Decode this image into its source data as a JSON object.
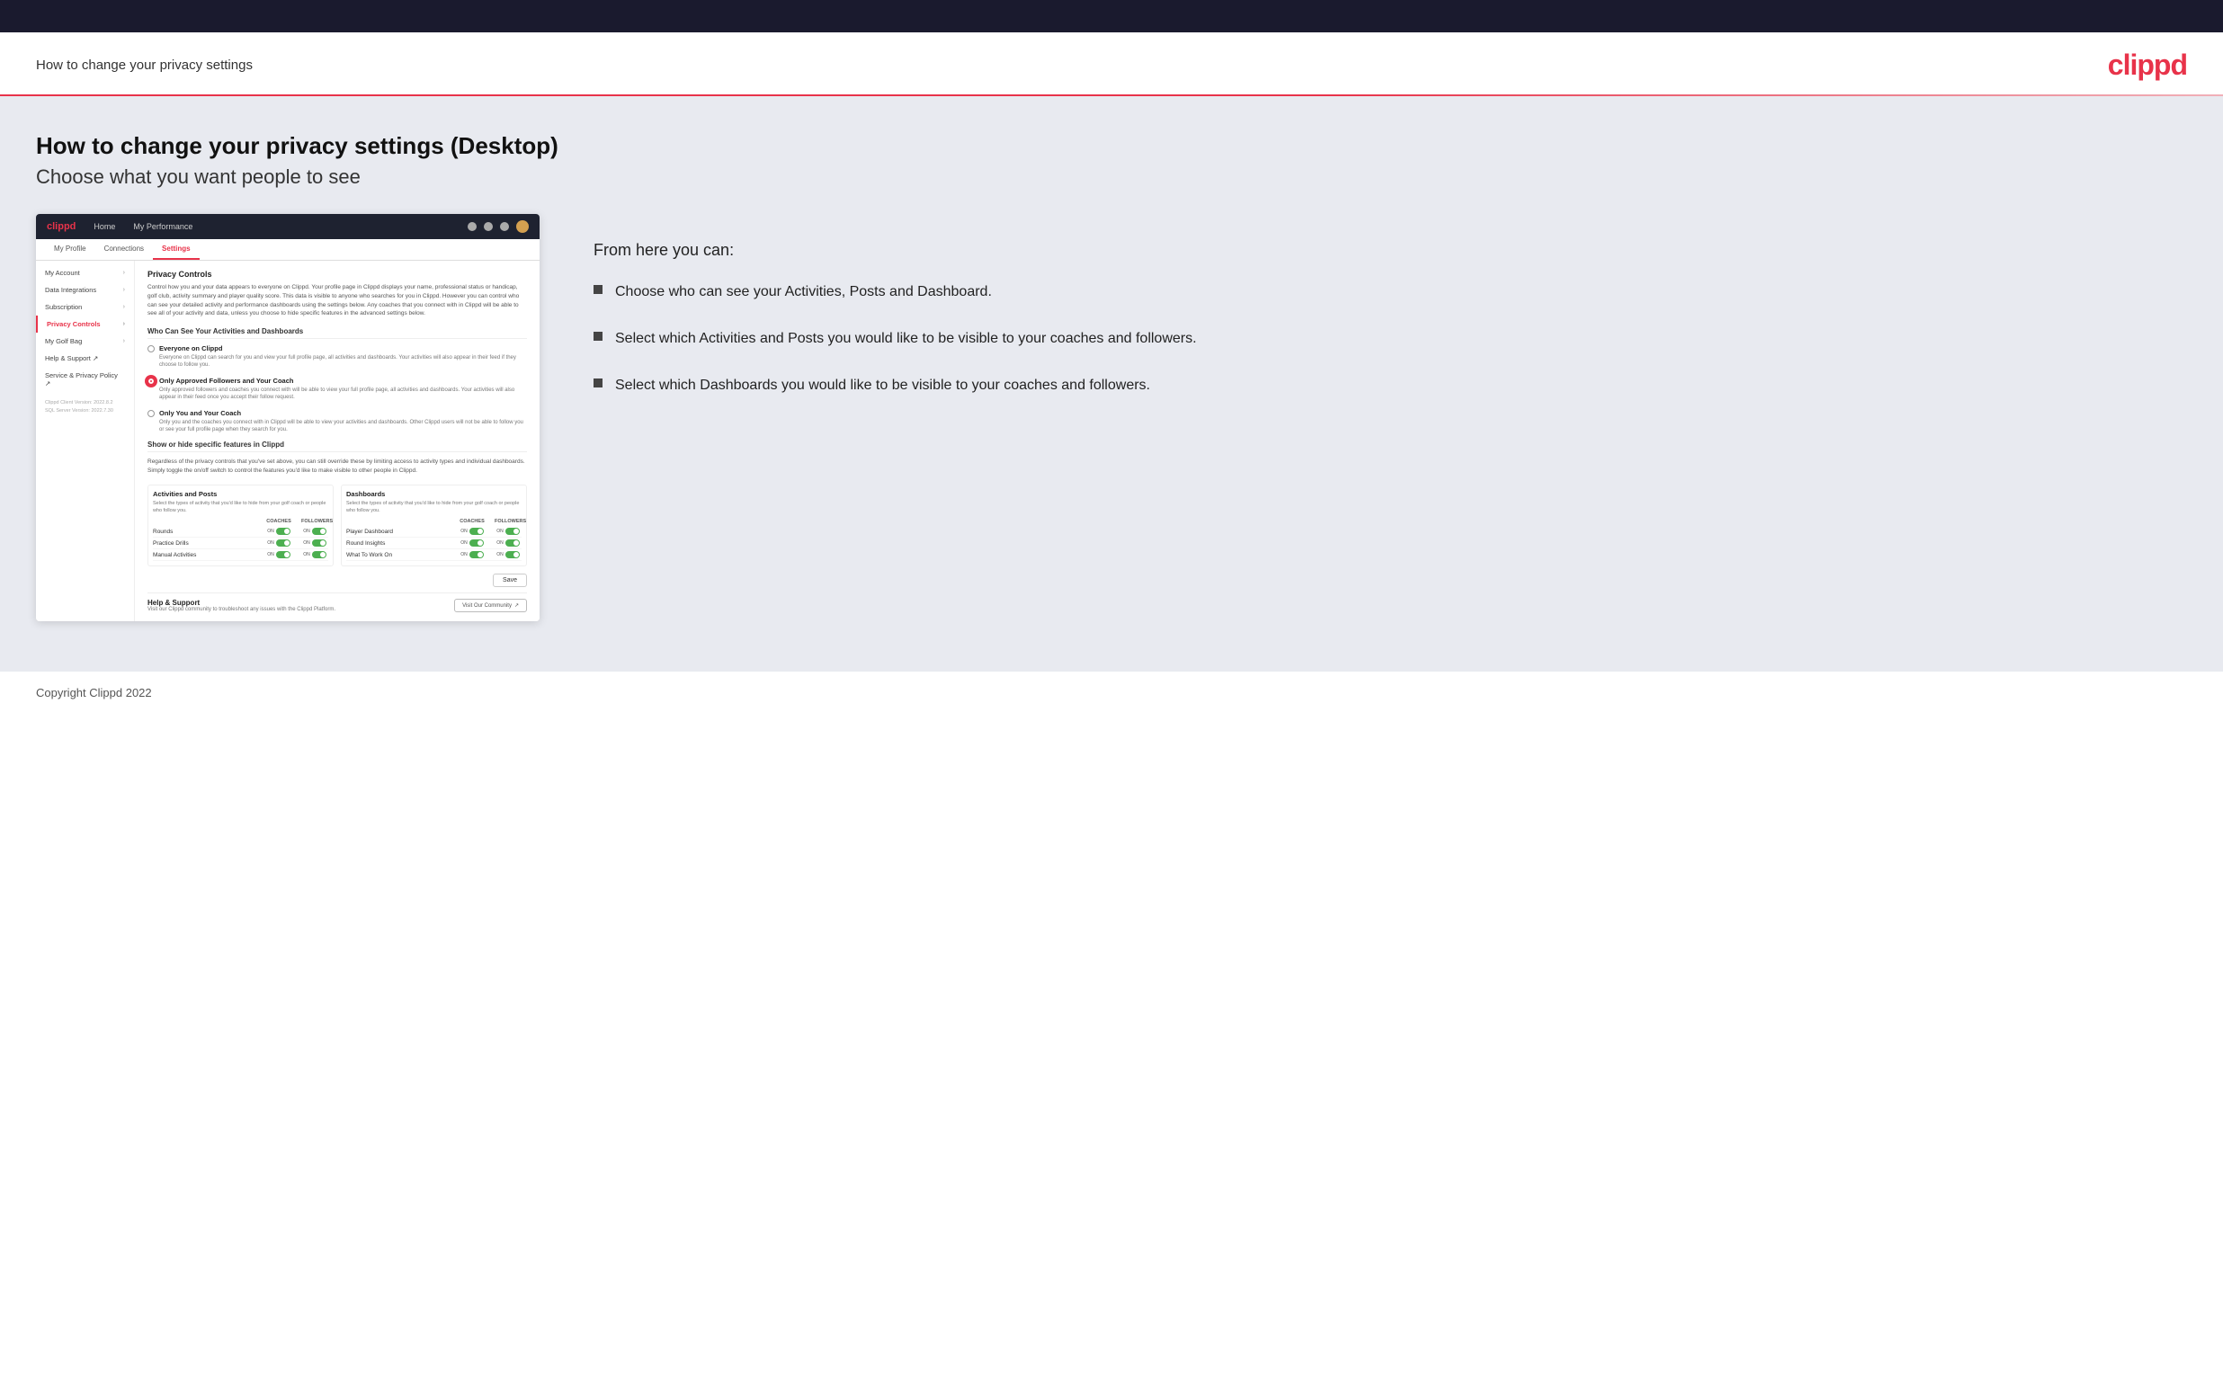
{
  "header": {
    "title": "How to change your privacy settings",
    "logo": "clippd"
  },
  "page": {
    "main_title": "How to change your privacy settings (Desktop)",
    "subtitle": "Choose what you want people to see"
  },
  "mockup": {
    "nav": {
      "logo": "clippd",
      "links": [
        "Home",
        "My Performance"
      ]
    },
    "tabs": [
      "My Profile",
      "Connections",
      "Settings"
    ],
    "active_tab": "Settings",
    "sidebar": {
      "items": [
        {
          "label": "My Account",
          "arrow": true,
          "active": false
        },
        {
          "label": "Data Integrations",
          "arrow": true,
          "active": false
        },
        {
          "label": "Subscription",
          "arrow": true,
          "active": false
        },
        {
          "label": "Privacy Controls",
          "arrow": true,
          "active": true
        },
        {
          "label": "My Golf Bag",
          "arrow": true,
          "active": false
        },
        {
          "label": "Help & Support",
          "external": true,
          "active": false
        },
        {
          "label": "Service & Privacy Policy",
          "external": true,
          "active": false
        }
      ],
      "version": "Clippd Client Version: 2022.8.2\nSQL Server Version: 2022.7.30"
    },
    "main": {
      "section_title": "Privacy Controls",
      "section_desc": "Control how you and your data appears to everyone on Clippd. Your profile page in Clippd displays your name, professional status or handicap, golf club, activity summary and player quality score. This data is visible to anyone who searches for you in Clippd. However you can control who can see your detailed activity and performance dashboards using the settings below. Any coaches that you connect with in Clippd will be able to see all of your activity and data, unless you choose to hide specific features in the advanced settings below.",
      "subsection_title": "Who Can See Your Activities and Dashboards",
      "radio_options": [
        {
          "label": "Everyone on Clippd",
          "desc": "Everyone on Clippd can search for you and view your full profile page, all activities and dashboards. Your activities will also appear in their feed if they choose to follow you.",
          "selected": false
        },
        {
          "label": "Only Approved Followers and Your Coach",
          "desc": "Only approved followers and coaches you connect with will be able to view your full profile page, all activities and dashboards. Your activities will also appear in their feed once you accept their follow request.",
          "selected": true
        },
        {
          "label": "Only You and Your Coach",
          "desc": "Only you and the coaches you connect with in Clippd will be able to view your activities and dashboards. Other Clippd users will not be able to follow you or see your full profile page when they search for you.",
          "selected": false
        }
      ],
      "show_hide_title": "Show or hide specific features in Clippd",
      "show_hide_desc": "Regardless of the privacy controls that you've set above, you can still override these by limiting access to activity types and individual dashboards. Simply toggle the on/off switch to control the features you'd like to make visible to other people in Clippd.",
      "activities_panel": {
        "title": "Activities and Posts",
        "desc": "Select the types of activity that you'd like to hide from your golf coach or people who follow you.",
        "col_headers": [
          "COACHES",
          "FOLLOWERS"
        ],
        "rows": [
          {
            "name": "Rounds",
            "coaches_on": true,
            "followers_on": true
          },
          {
            "name": "Practice Drills",
            "coaches_on": true,
            "followers_on": true
          },
          {
            "name": "Manual Activities",
            "coaches_on": true,
            "followers_on": true
          }
        ]
      },
      "dashboards_panel": {
        "title": "Dashboards",
        "desc": "Select the types of activity that you'd like to hide from your golf coach or people who follow you.",
        "col_headers": [
          "COACHES",
          "FOLLOWERS"
        ],
        "rows": [
          {
            "name": "Player Dashboard",
            "coaches_on": true,
            "followers_on": true
          },
          {
            "name": "Round Insights",
            "coaches_on": true,
            "followers_on": true
          },
          {
            "name": "What To Work On",
            "coaches_on": true,
            "followers_on": true
          }
        ]
      },
      "save_button": "Save",
      "help_title": "Help & Support",
      "help_desc": "Visit our Clippd community to troubleshoot any issues with the Clippd Platform.",
      "visit_button": "Visit Our Community"
    }
  },
  "info_panel": {
    "intro": "From here you can:",
    "bullets": [
      "Choose who can see your Activities, Posts and Dashboard.",
      "Select which Activities and Posts you would like to be visible to your coaches and followers.",
      "Select which Dashboards you would like to be visible to your coaches and followers."
    ]
  },
  "footer": {
    "text": "Copyright Clippd 2022"
  }
}
